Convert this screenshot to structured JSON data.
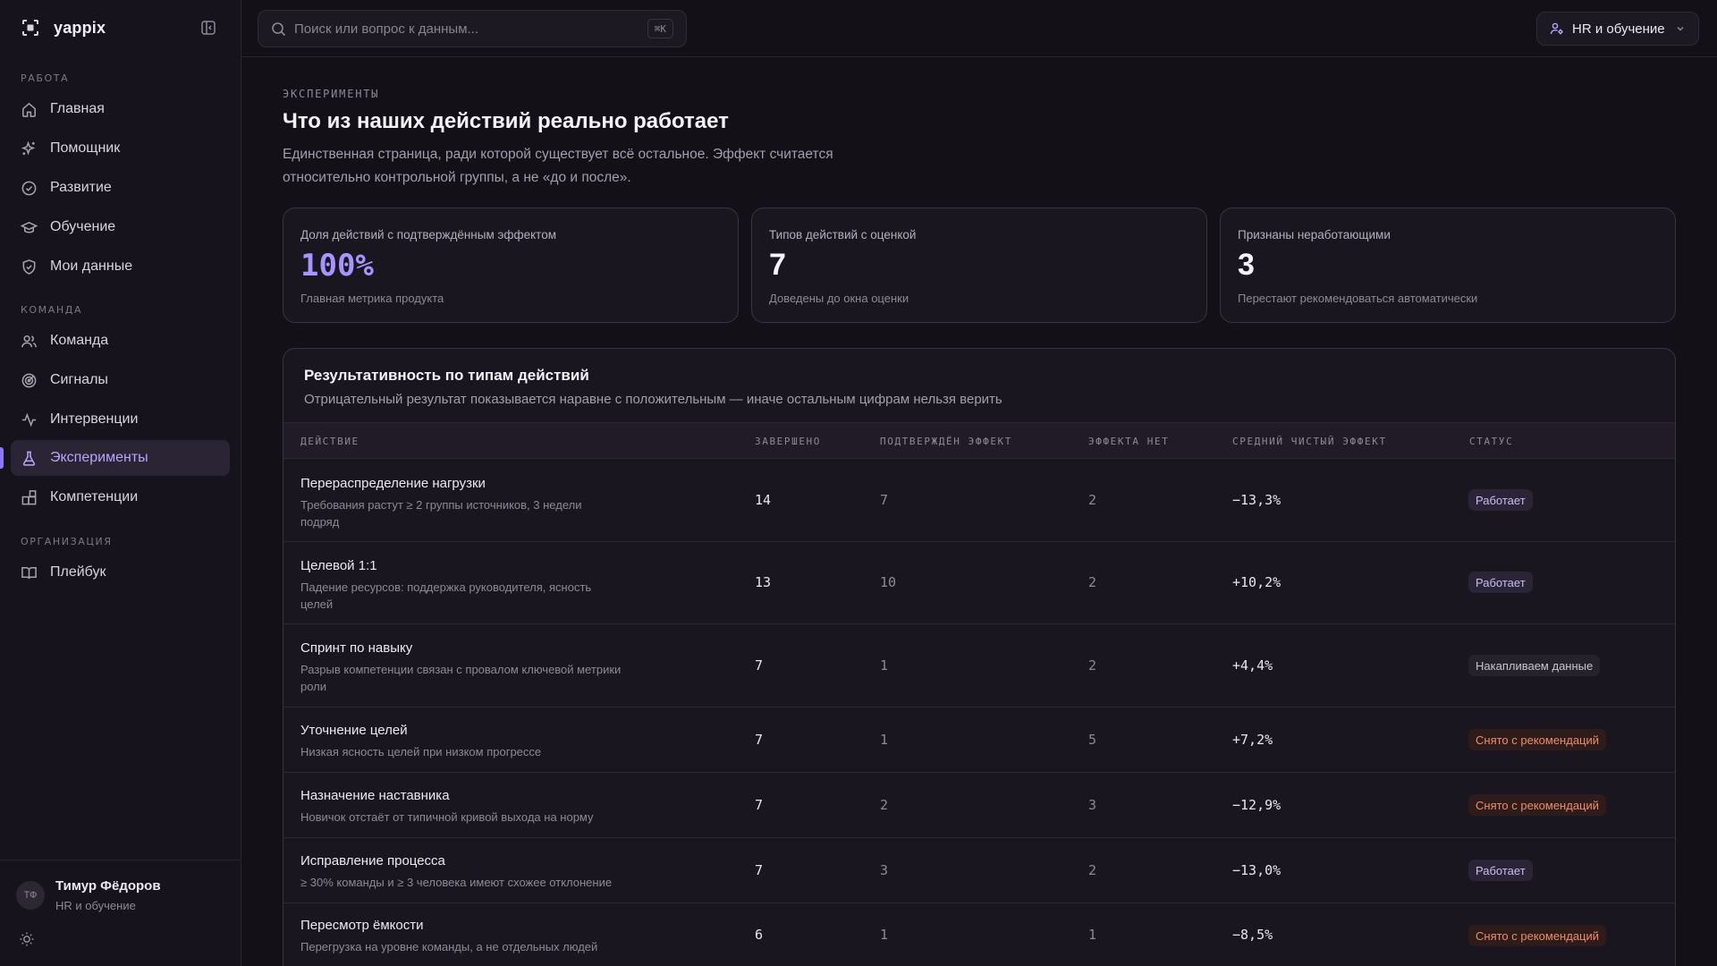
{
  "brand": {
    "name": "yappix"
  },
  "sidebar": {
    "sections": [
      {
        "label": "РАБОТА",
        "items": [
          "Главная",
          "Помощник",
          "Развитие",
          "Обучение",
          "Мои данные"
        ]
      },
      {
        "label": "КОМАНДА",
        "items": [
          "Команда",
          "Сигналы",
          "Интервенции",
          "Эксперименты",
          "Компетенции"
        ]
      },
      {
        "label": "ОРГАНИЗАЦИЯ",
        "items": [
          "Плейбук"
        ]
      }
    ],
    "active_item": "Эксперименты",
    "user": {
      "initials": "ТФ",
      "name": "Тимур Фёдоров",
      "role": "HR и обучение"
    }
  },
  "topbar": {
    "search_placeholder": "Поиск или вопрос к данным...",
    "shortcut": "⌘K",
    "role": "HR и обучение"
  },
  "page": {
    "eyebrow": "ЭКСПЕРИМЕНТЫ",
    "title": "Что из наших действий реально работает",
    "description": "Единственная страница, ради которой существует всё остальное. Эффект считается относительно контрольной группы, а не «до и после»."
  },
  "kpis": [
    {
      "label": "Доля действий с подтверждённым эффектом",
      "value": "100%",
      "note": "Главная метрика продукта"
    },
    {
      "label": "Типов действий с оценкой",
      "value": "7",
      "note": "Доведены до окна оценки"
    },
    {
      "label": "Признаны неработающими",
      "value": "3",
      "note": "Перестают рекомендоваться автоматически"
    }
  ],
  "table": {
    "title": "Результативность по типам действий",
    "subtitle": "Отрицательный результат показывается наравне с положительным — иначе остальным цифрам нельзя верить",
    "columns": [
      "ДЕЙСТВИЕ",
      "ЗАВЕРШЕНО",
      "ПОДТВЕРЖДЁН ЭФФЕКТ",
      "ЭФФЕКТА НЕТ",
      "СРЕДНИЙ ЧИСТЫЙ ЭФФЕКТ",
      "СТАТУС"
    ],
    "rows": [
      {
        "name": "Перераспределение нагрузки",
        "desc": "Требования растут ≥ 2 группы источников, 3 недели подряд",
        "done": "14",
        "confirmed": "7",
        "none": "2",
        "effect": "−13,3%",
        "status": "Работает"
      },
      {
        "name": "Целевой 1:1",
        "desc": "Падение ресурсов: поддержка руководителя, ясность целей",
        "done": "13",
        "confirmed": "10",
        "none": "2",
        "effect": "+10,2%",
        "status": "Работает"
      },
      {
        "name": "Спринт по навыку",
        "desc": "Разрыв компетенции связан с провалом ключевой метрики роли",
        "done": "7",
        "confirmed": "1",
        "none": "2",
        "effect": "+4,4%",
        "status": "Накапливаем данные"
      },
      {
        "name": "Уточнение целей",
        "desc": "Низкая ясность целей при низком прогрессе",
        "done": "7",
        "confirmed": "1",
        "none": "5",
        "effect": "+7,2%",
        "status": "Снято с рекомендаций"
      },
      {
        "name": "Назначение наставника",
        "desc": "Новичок отстаёт от типичной кривой выхода на норму",
        "done": "7",
        "confirmed": "2",
        "none": "3",
        "effect": "−12,9%",
        "status": "Снято с рекомендаций"
      },
      {
        "name": "Исправление процесса",
        "desc": "≥ 30% команды и ≥ 3 человека имеют схожее отклонение",
        "done": "7",
        "confirmed": "3",
        "none": "2",
        "effect": "−13,0%",
        "status": "Работает"
      },
      {
        "name": "Пересмотр ёмкости",
        "desc": "Перегрузка на уровне команды, а не отдельных людей",
        "done": "6",
        "confirmed": "1",
        "none": "1",
        "effect": "−8,5%",
        "status": "Снято с рекомендаций"
      }
    ]
  },
  "colors": {
    "accent": "#a993ff",
    "background": "#141018",
    "status_off": "#f08a6e"
  }
}
